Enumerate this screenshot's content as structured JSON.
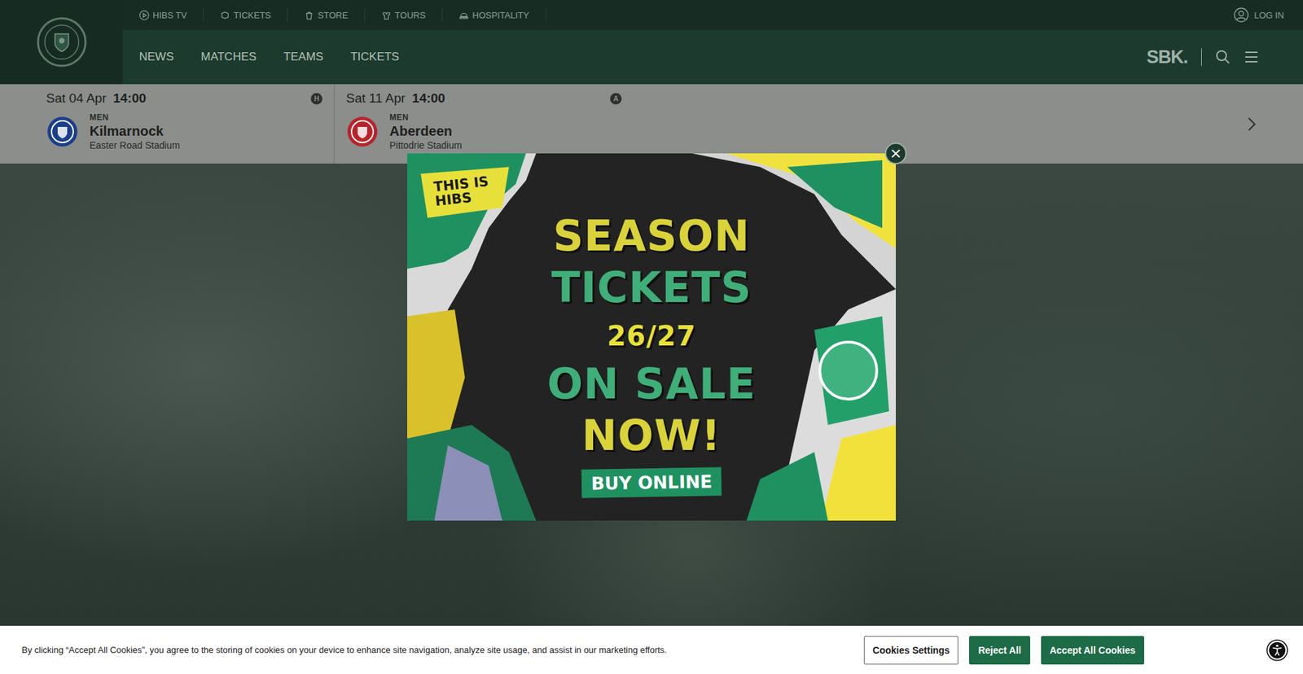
{
  "top_links": [
    {
      "label": "HIBS TV"
    },
    {
      "label": "TICKETS"
    },
    {
      "label": "STORE"
    },
    {
      "label": "TOURS"
    },
    {
      "label": "HOSPITALITY"
    }
  ],
  "login": "LOG IN",
  "nav": [
    {
      "label": "NEWS"
    },
    {
      "label": "MATCHES"
    },
    {
      "label": "TEAMS"
    },
    {
      "label": "TICKETS"
    }
  ],
  "sponsor": "SBK.",
  "fixtures": [
    {
      "date": "Sat 04 Apr",
      "time": "14:00",
      "venue_badge": "H",
      "category": "MEN",
      "opponent": "Kilmarnock",
      "stadium": "Easter Road Stadium",
      "color": "#1d3f8a"
    },
    {
      "date": "Sat 11 Apr",
      "time": "14:00",
      "venue_badge": "A",
      "category": "MEN",
      "opponent": "Aberdeen",
      "stadium": "Pittodrie Stadium",
      "color": "#b8242c"
    }
  ],
  "modal": {
    "close": "×",
    "tagline": "THIS IS HIBS",
    "headline": [
      "SEASON",
      "TICKETS",
      "26/27",
      "ON SALE",
      "NOW!"
    ],
    "button": "BUY ONLINE"
  },
  "cookie_banner": {
    "text": "By clicking “Accept All Cookies”, you agree to the storing of cookies on your device to enhance site navigation, analyze site usage, and assist in our marketing efforts.",
    "buttons": [
      {
        "label": "Cookies Settings",
        "kind": "outline"
      },
      {
        "label": "Reject All",
        "kind": "filled"
      },
      {
        "label": "Accept All Cookies",
        "kind": "filled"
      }
    ]
  }
}
